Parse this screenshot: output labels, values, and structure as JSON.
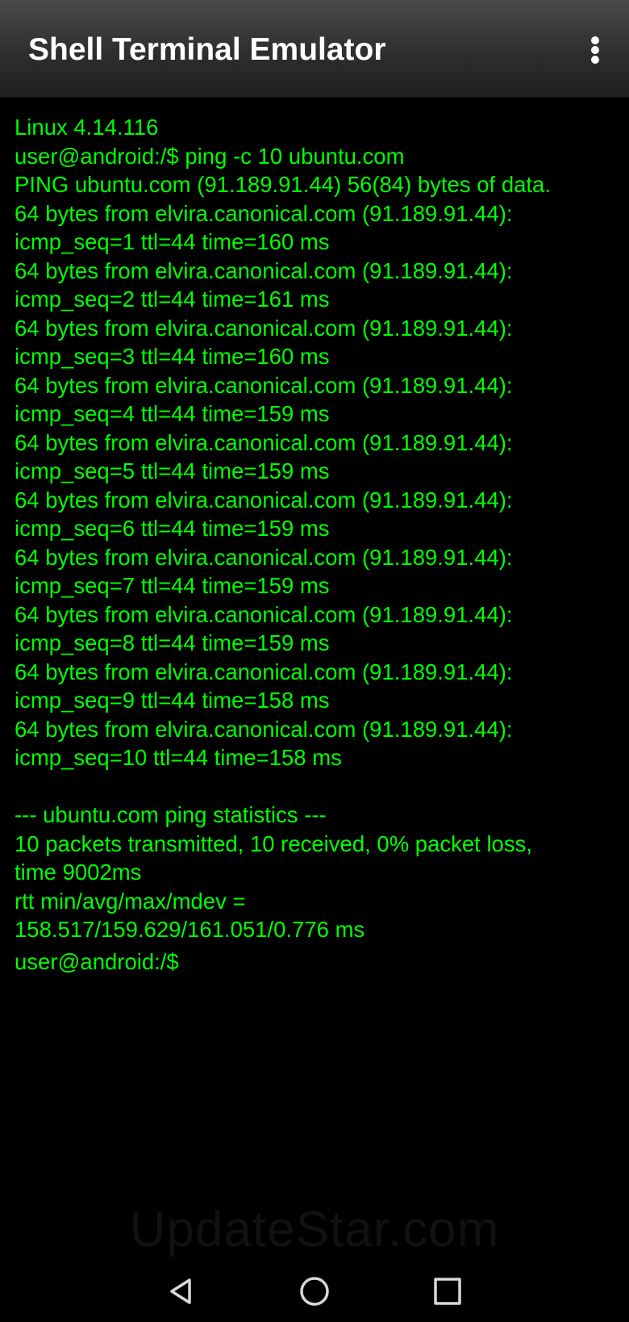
{
  "app_bar": {
    "title": "Shell Terminal Emulator",
    "menu_icon": "more-vert-icon"
  },
  "terminal": {
    "text_color": "#00ff00",
    "lines": [
      "Linux 4.14.116",
      "user@android:/$ ping -c 10 ubuntu.com",
      "PING ubuntu.com (91.189.91.44) 56(84) bytes of data.",
      "64 bytes from elvira.canonical.com (91.189.91.44):",
      "icmp_seq=1 ttl=44 time=160 ms",
      "64 bytes from elvira.canonical.com (91.189.91.44):",
      "icmp_seq=2 ttl=44 time=161 ms",
      "64 bytes from elvira.canonical.com (91.189.91.44):",
      "icmp_seq=3 ttl=44 time=160 ms",
      "64 bytes from elvira.canonical.com (91.189.91.44):",
      "icmp_seq=4 ttl=44 time=159 ms",
      "64 bytes from elvira.canonical.com (91.189.91.44):",
      "icmp_seq=5 ttl=44 time=159 ms",
      "64 bytes from elvira.canonical.com (91.189.91.44):",
      "icmp_seq=6 ttl=44 time=159 ms",
      "64 bytes from elvira.canonical.com (91.189.91.44):",
      "icmp_seq=7 ttl=44 time=159 ms",
      "64 bytes from elvira.canonical.com (91.189.91.44):",
      "icmp_seq=8 ttl=44 time=159 ms",
      "64 bytes from elvira.canonical.com (91.189.91.44):",
      "icmp_seq=9 ttl=44 time=158 ms",
      "64 bytes from elvira.canonical.com (91.189.91.44):",
      "icmp_seq=10 ttl=44 time=158 ms",
      "",
      "--- ubuntu.com ping statistics ---",
      "10 packets transmitted, 10 received, 0% packet loss,",
      "time 9002ms",
      "rtt min/avg/max/mdev =",
      "158.517/159.629/161.051/0.776 ms"
    ],
    "prompt": "user@android:/$"
  },
  "watermark": "UpdateStar.com",
  "nav_bar": {
    "back_icon": "back-triangle-icon",
    "home_icon": "home-circle-icon",
    "recents_icon": "recents-square-icon"
  }
}
